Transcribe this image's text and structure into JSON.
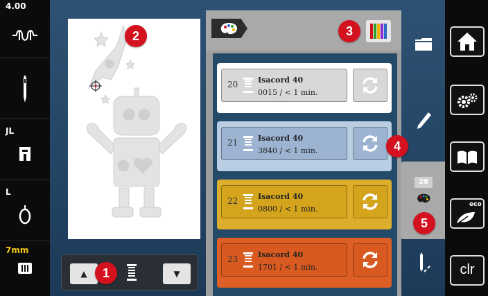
{
  "status": {
    "stitch_width": "4.00",
    "presser_foot": "JL",
    "tension_level": "L",
    "needle_size": "7mm"
  },
  "color_list": [
    {
      "number": "20",
      "thread": "Isacord 40",
      "detail": "0015 / < 1 min.",
      "color": "#d8d8d8",
      "row_bg": "#ffffff"
    },
    {
      "number": "21",
      "thread": "Isacord 40",
      "detail": "3840 / < 1 min.",
      "color": "#9cb4d2",
      "row_bg": "#b9cde3"
    },
    {
      "number": "22",
      "thread": "Isacord 40",
      "detail": "0800 / < 1 min.",
      "color": "#d4a41c",
      "row_bg": "#dcae2c"
    },
    {
      "number": "23",
      "thread": "Isacord 40",
      "detail": "1701 / < 1 min.",
      "color": "#d85a20",
      "row_bg": "#dd5f25"
    }
  ],
  "color_count": "28",
  "callouts": [
    "1",
    "2",
    "3",
    "4",
    "5"
  ],
  "right_buttons": {
    "clr_label": "clr",
    "eco_label": "eco"
  },
  "icons": {
    "home": "home-icon",
    "settings": "gears-icon",
    "tutorial": "book-icon",
    "eco": "eco-leaf-icon",
    "folder": "folder-icon",
    "pencil": "pencil-icon",
    "palette": "palette-icon",
    "stitch": "needle-stitch-icon"
  },
  "accent_red": "#d4111e"
}
